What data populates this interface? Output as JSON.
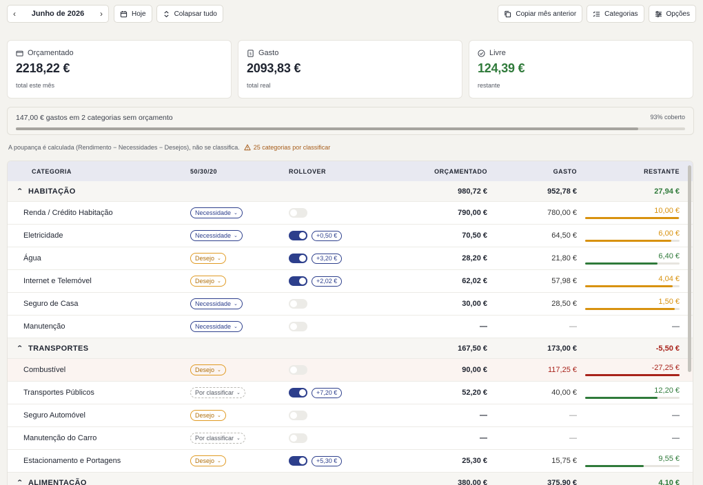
{
  "toolbar": {
    "month": "Junho de 2026",
    "today": "Hoje",
    "collapse": "Colapsar tudo",
    "copy_prev": "Copiar mês anterior",
    "categories": "Categorias",
    "options": "Opções"
  },
  "cards": {
    "budgeted": {
      "label": "Orçamentado",
      "value": "2218,22 €",
      "sub": "total este mês"
    },
    "spent": {
      "label": "Gasto",
      "value": "2093,83 €",
      "sub": "total real"
    },
    "free": {
      "label": "Livre",
      "value": "124,39 €",
      "sub": "restante"
    }
  },
  "coverage": {
    "text": "147,00 € gastos em 2 categorias sem orçamento",
    "pct_label": "93% coberto",
    "fraction": 0.93
  },
  "note": {
    "text": "A poupança é calculada (Rendimento − Necessidades − Desejos), não se classifica.",
    "warn": "25 categorias por classificar"
  },
  "table": {
    "headers": {
      "category": "CATEGORIA",
      "rule": "50/30/20",
      "rollover": "ROLLOVER",
      "budgeted": "ORÇAMENTADO",
      "spent": "GASTO",
      "remaining": "RESTANTE"
    },
    "colors": {
      "amber": "#d8920f",
      "green": "#2f7a3a",
      "red": "#a8221a",
      "navy": "#2d3f8c"
    },
    "groups": [
      {
        "name": "HABITAÇÃO",
        "budgeted": "980,72 €",
        "spent": "952,78 €",
        "remaining": "27,94 €",
        "remaining_tone": "green",
        "rows": [
          {
            "name": "Renda / Crédito Habitação",
            "tag": "Necessidade",
            "tag_kind": "nec",
            "rollover_on": false,
            "rollover": "",
            "budgeted": "790,00 €",
            "spent": "780,00 €",
            "remaining": "10,00 €",
            "tone": "amber",
            "fill": 0.99
          },
          {
            "name": "Eletricidade",
            "tag": "Necessidade",
            "tag_kind": "nec",
            "rollover_on": true,
            "rollover": "+0,50 €",
            "budgeted": "70,50 €",
            "spent": "64,50 €",
            "remaining": "6,00 €",
            "tone": "amber",
            "fill": 0.91
          },
          {
            "name": "Água",
            "tag": "Desejo",
            "tag_kind": "des",
            "rollover_on": true,
            "rollover": "+3,20 €",
            "budgeted": "28,20 €",
            "spent": "21,80 €",
            "remaining": "6,40 €",
            "tone": "green",
            "fill": 0.77
          },
          {
            "name": "Internet e Telemóvel",
            "tag": "Desejo",
            "tag_kind": "des",
            "rollover_on": true,
            "rollover": "+2,02 €",
            "budgeted": "62,02 €",
            "spent": "57,98 €",
            "remaining": "4,04 €",
            "tone": "amber",
            "fill": 0.93
          },
          {
            "name": "Seguro de Casa",
            "tag": "Necessidade",
            "tag_kind": "nec",
            "rollover_on": false,
            "rollover": "",
            "budgeted": "30,00 €",
            "spent": "28,50 €",
            "remaining": "1,50 €",
            "tone": "amber",
            "fill": 0.95
          },
          {
            "name": "Manutenção",
            "tag": "Necessidade",
            "tag_kind": "nec",
            "rollover_on": false,
            "rollover": "",
            "budgeted": "—",
            "spent": "—",
            "remaining": "—",
            "tone": "dark",
            "fill": null
          }
        ]
      },
      {
        "name": "TRANSPORTES",
        "budgeted": "167,50 €",
        "spent": "173,00 €",
        "remaining": "-5,50 €",
        "remaining_tone": "red",
        "rows": [
          {
            "name": "Combustível",
            "tag": "Desejo",
            "tag_kind": "des",
            "rollover_on": false,
            "rollover": "",
            "budgeted": "90,00 €",
            "spent": "117,25 €",
            "remaining": "-27,25 €",
            "tone": "red",
            "fill": 1.0,
            "over": true
          },
          {
            "name": "Transportes Públicos",
            "tag": "Por classificar",
            "tag_kind": "unc",
            "rollover_on": true,
            "rollover": "+7,20 €",
            "budgeted": "52,20 €",
            "spent": "40,00 €",
            "remaining": "12,20 €",
            "tone": "green",
            "fill": 0.77
          },
          {
            "name": "Seguro Automóvel",
            "tag": "Desejo",
            "tag_kind": "des",
            "rollover_on": false,
            "rollover": "",
            "budgeted": "—",
            "spent": "—",
            "remaining": "—",
            "tone": "dark",
            "fill": null
          },
          {
            "name": "Manutenção do Carro",
            "tag": "Por classificar",
            "tag_kind": "unc",
            "rollover_on": false,
            "rollover": "",
            "budgeted": "—",
            "spent": "—",
            "remaining": "—",
            "tone": "dark",
            "fill": null
          },
          {
            "name": "Estacionamento e Portagens",
            "tag": "Desejo",
            "tag_kind": "des",
            "rollover_on": true,
            "rollover": "+5,30 €",
            "budgeted": "25,30 €",
            "spent": "15,75 €",
            "remaining": "9,55 €",
            "tone": "green",
            "fill": 0.62
          }
        ]
      },
      {
        "name": "ALIMENTAÇÃO",
        "budgeted": "380,00 €",
        "spent": "375,90 €",
        "remaining": "4,10 €",
        "remaining_tone": "green",
        "rows": []
      }
    ]
  }
}
